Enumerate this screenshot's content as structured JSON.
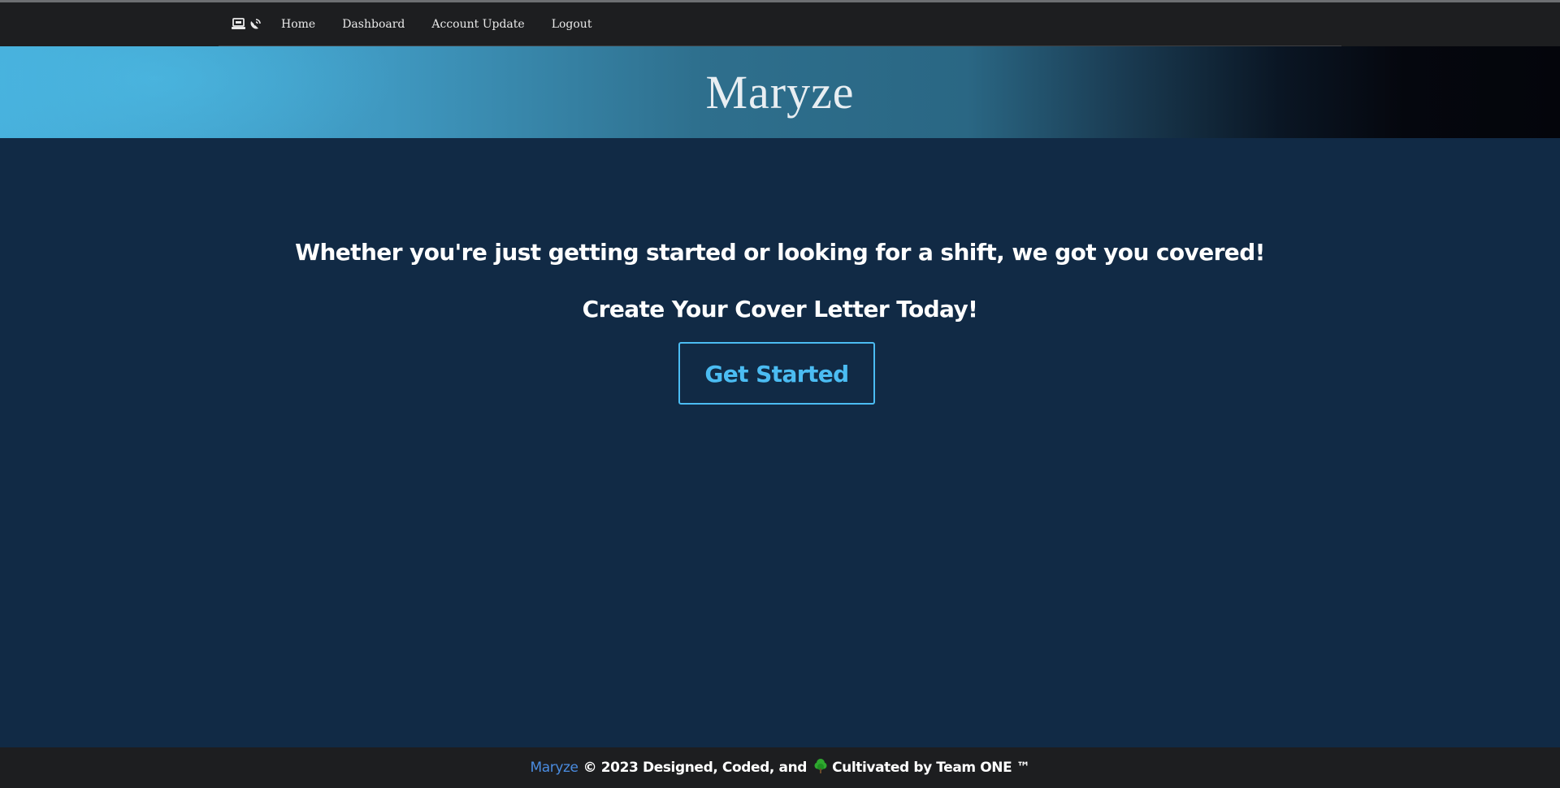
{
  "nav": {
    "brand_icons": [
      "laptop-icon",
      "satellite-dish-icon"
    ],
    "links": [
      {
        "label": "Home"
      },
      {
        "label": "Dashboard"
      },
      {
        "label": "Account Update"
      },
      {
        "label": "Logout"
      }
    ]
  },
  "hero": {
    "title": "Maryze"
  },
  "main": {
    "tagline": "Whether you're just getting started or looking for a shift, we got you covered!",
    "cta_heading": "Create Your Cover Letter Today!",
    "cta_button_label": "Get Started"
  },
  "footer": {
    "brand": "Maryze",
    "text_before_icon": "© 2023 Designed, Coded, and",
    "icon": "tree-icon",
    "text_after_icon": "Cultivated by Team ONE ™"
  },
  "colors": {
    "navbar_bg": "#1d1e20",
    "page_bg": "#112a45",
    "accent": "#4bbcf2",
    "footer_link": "#4a8ce0",
    "hero_gradient_start": "#47b0dc",
    "hero_gradient_end": "#04050b"
  }
}
